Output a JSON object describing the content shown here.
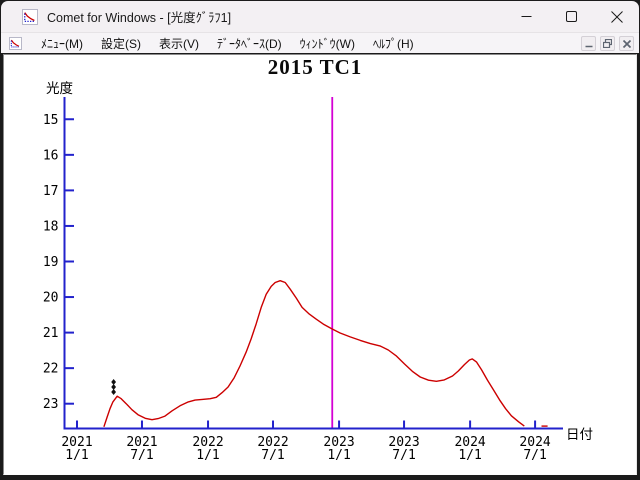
{
  "window": {
    "title": "Comet for Windows - [光度ｸﾞﾗﾌ1]",
    "app_icon": "comet-lightcurve-icon",
    "controls": {
      "minimize": "minimize",
      "maximize": "maximize",
      "close": "close"
    }
  },
  "menubar": {
    "items": [
      {
        "label": "ﾒﾆｭｰ(M)"
      },
      {
        "label": "設定(S)"
      },
      {
        "label": "表示(V)"
      },
      {
        "label": "ﾃﾞｰﾀﾍﾞｰｽ(D)"
      },
      {
        "label": "ｳｨﾝﾄﾞｳ(W)"
      },
      {
        "label": "ﾍﾙﾌﾟ(H)"
      }
    ],
    "mdi_controls": {
      "minimize": "minimize-child",
      "restore": "restore-child",
      "close": "close-child"
    }
  },
  "chart_data": {
    "type": "line",
    "title": "2015 TC1",
    "ylabel": "光度",
    "xlabel": "日付",
    "axis_color": "#2222cc",
    "y_axis": {
      "inverted": true,
      "ticks": [
        15,
        16,
        17,
        18,
        19,
        20,
        21,
        22,
        23
      ],
      "range": [
        14.4,
        23.7
      ]
    },
    "x_axis": {
      "epoch": "2021-01-01",
      "tick_days": [
        0,
        181,
        365,
        546,
        730,
        911,
        1095,
        1276
      ],
      "tick_labels": [
        [
          "2021",
          "1/1"
        ],
        [
          "2021",
          "7/1"
        ],
        [
          "2022",
          "1/1"
        ],
        [
          "2022",
          "7/1"
        ],
        [
          "2023",
          "1/1"
        ],
        [
          "2023",
          "7/1"
        ],
        [
          "2024",
          "1/1"
        ],
        [
          "2024",
          "7/1"
        ]
      ]
    },
    "marker_line": {
      "day": 711,
      "color": "#d400d4"
    },
    "series": [
      {
        "name": "predicted-light-curve",
        "type": "line",
        "color": "#cc0000",
        "points": [
          [
            75,
            23.65
          ],
          [
            84,
            23.37
          ],
          [
            92,
            23.14
          ],
          [
            100,
            22.95
          ],
          [
            112,
            22.79
          ],
          [
            123,
            22.86
          ],
          [
            137,
            23.0
          ],
          [
            153,
            23.17
          ],
          [
            170,
            23.31
          ],
          [
            190,
            23.41
          ],
          [
            209,
            23.45
          ],
          [
            226,
            23.42
          ],
          [
            245,
            23.35
          ],
          [
            265,
            23.2
          ],
          [
            287,
            23.06
          ],
          [
            310,
            22.95
          ],
          [
            329,
            22.9
          ],
          [
            349,
            22.88
          ],
          [
            371,
            22.86
          ],
          [
            388,
            22.82
          ],
          [
            404,
            22.69
          ],
          [
            421,
            22.53
          ],
          [
            438,
            22.27
          ],
          [
            454,
            21.94
          ],
          [
            471,
            21.55
          ],
          [
            485,
            21.18
          ],
          [
            499,
            20.76
          ],
          [
            513,
            20.29
          ],
          [
            527,
            19.92
          ],
          [
            541,
            19.7
          ],
          [
            552,
            19.59
          ],
          [
            566,
            19.54
          ],
          [
            580,
            19.59
          ],
          [
            594,
            19.78
          ],
          [
            611,
            20.03
          ],
          [
            627,
            20.29
          ],
          [
            647,
            20.48
          ],
          [
            666,
            20.62
          ],
          [
            686,
            20.76
          ],
          [
            711,
            20.9
          ],
          [
            733,
            21.01
          ],
          [
            761,
            21.12
          ],
          [
            789,
            21.22
          ],
          [
            817,
            21.31
          ],
          [
            845,
            21.38
          ],
          [
            867,
            21.49
          ],
          [
            890,
            21.66
          ],
          [
            912,
            21.88
          ],
          [
            934,
            22.09
          ],
          [
            956,
            22.25
          ],
          [
            979,
            22.34
          ],
          [
            1001,
            22.37
          ],
          [
            1023,
            22.33
          ],
          [
            1046,
            22.22
          ],
          [
            1062,
            22.08
          ],
          [
            1079,
            21.9
          ],
          [
            1093,
            21.77
          ],
          [
            1101,
            21.74
          ],
          [
            1113,
            21.83
          ],
          [
            1127,
            22.05
          ],
          [
            1143,
            22.33
          ],
          [
            1160,
            22.61
          ],
          [
            1177,
            22.89
          ],
          [
            1194,
            23.14
          ],
          [
            1210,
            23.34
          ],
          [
            1230,
            23.51
          ],
          [
            1246,
            23.63
          ]
        ]
      },
      {
        "name": "light-curve-tail-segment",
        "type": "line",
        "color": "#cc0000",
        "points": [
          [
            1294,
            23.63
          ],
          [
            1311,
            23.63
          ]
        ]
      },
      {
        "name": "observations",
        "type": "scatter",
        "color": "#111111",
        "points": [
          [
            102,
            22.39
          ],
          [
            102,
            22.53
          ],
          [
            102,
            22.67
          ]
        ]
      }
    ]
  }
}
